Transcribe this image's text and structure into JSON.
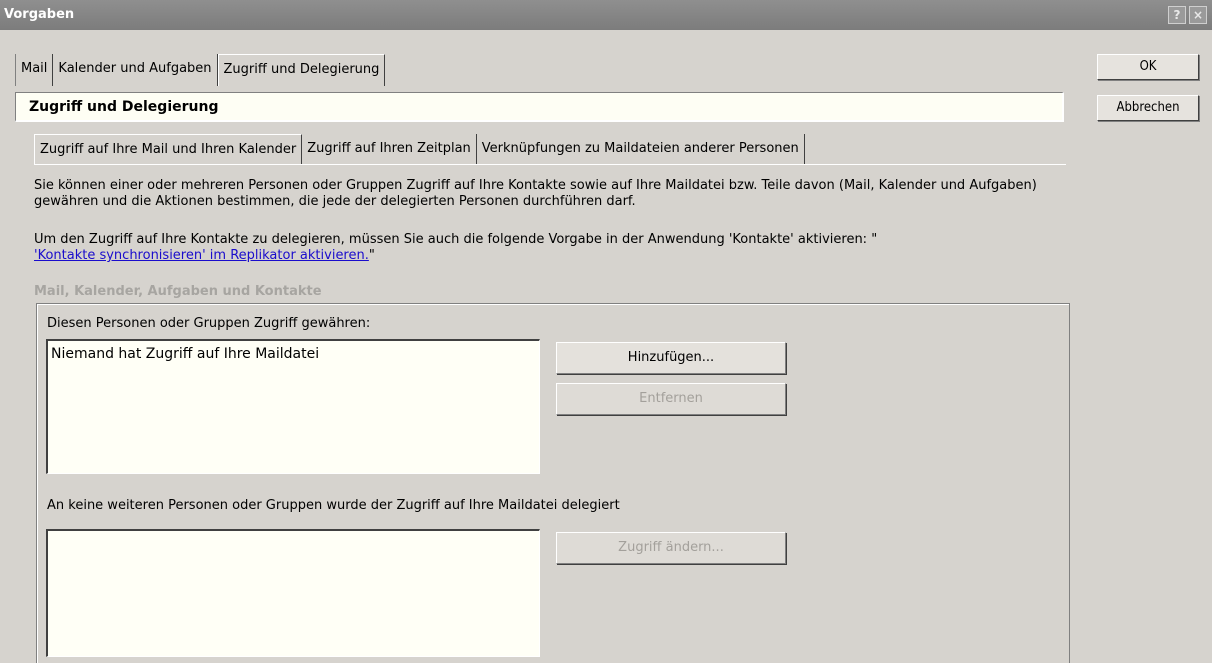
{
  "window": {
    "title": "Vorgaben",
    "help_label": "?",
    "close_label": "×"
  },
  "outer_tabs": [
    {
      "label": "Mail"
    },
    {
      "label": "Kalender und Aufgaben"
    },
    {
      "label": "Zugriff und Delegierung"
    }
  ],
  "section_title": "Zugriff und Delegierung",
  "buttons": {
    "ok": "OK",
    "cancel": "Abbrechen"
  },
  "inner_tabs": [
    {
      "label": "Zugriff auf Ihre Mail und Ihren Kalender"
    },
    {
      "label": "Zugriff auf Ihren Zeitplan"
    },
    {
      "label": "Verknüpfungen zu Maildateien anderer Personen"
    }
  ],
  "description": {
    "para1": "Sie können einer oder mehreren Personen oder Gruppen Zugriff auf Ihre Kontakte sowie auf Ihre Maildatei bzw. Teile davon (Mail, Kalender und Aufgaben) gewähren und die Aktionen bestimmen, die jede der delegierten Personen durchführen darf.",
    "para2_prefix": "Um den Zugriff auf Ihre Kontakte zu delegieren, müssen Sie auch die folgende Vorgabe in der Anwendung 'Kontakte' aktivieren: \"",
    "para2_link": "'Kontakte synchronisieren' im Replikator aktivieren.",
    "para2_suffix": "\""
  },
  "group": {
    "title": "Mail, Kalender, Aufgaben und Kontakte",
    "grant_label": "Diesen Personen oder Gruppen Zugriff gewähren:",
    "grant_list_item": "Niemand hat Zugriff auf Ihre Maildatei",
    "add_button": "Hinzufügen...",
    "remove_button": "Entfernen",
    "none_label": "An keine weiteren Personen oder Gruppen wurde der Zugriff auf Ihre Maildatei delegiert",
    "change_button": "Zugriff ändern..."
  }
}
